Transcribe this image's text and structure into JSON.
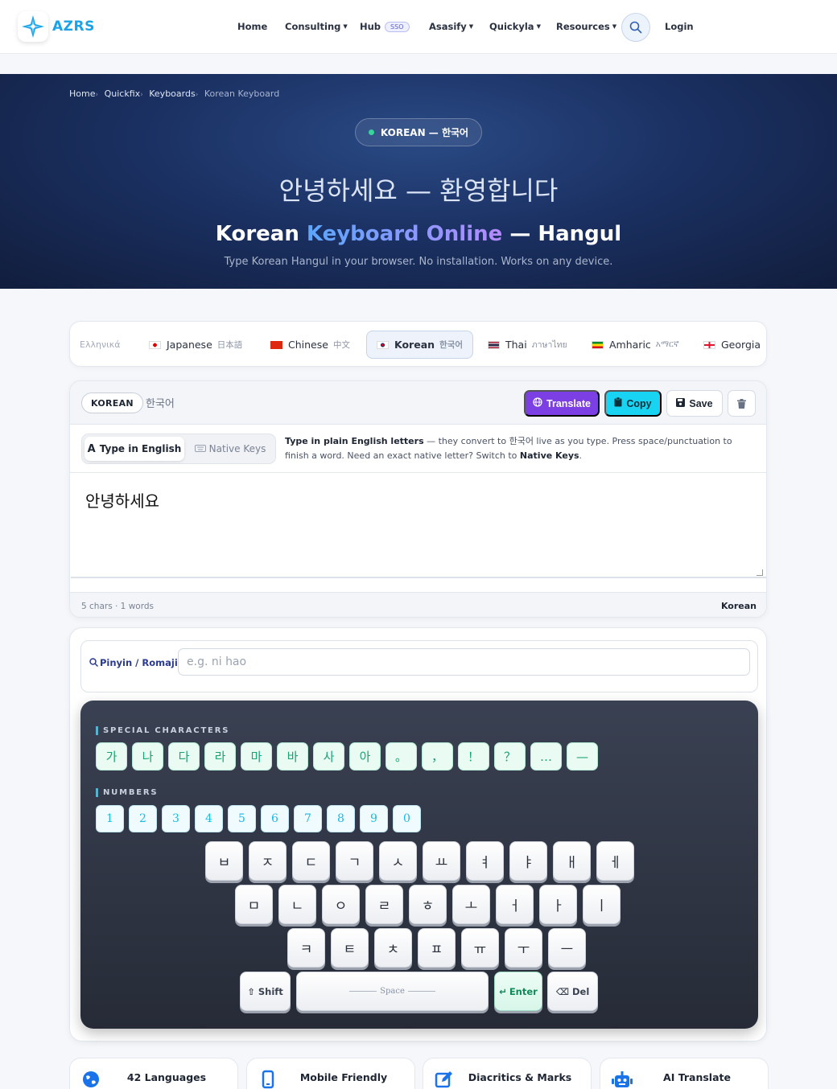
{
  "brand": {
    "name": "AZRS",
    "icon": "compass-star-icon",
    "color": "#1aa3e8"
  },
  "nav": {
    "items": [
      {
        "label": "Home",
        "dropdown": false
      },
      {
        "label": "Consulting",
        "dropdown": true
      },
      {
        "label": "Hub",
        "dropdown": false,
        "badge": "SSO"
      },
      {
        "label": "Asasify",
        "dropdown": true
      },
      {
        "label": "Quickyla",
        "dropdown": true
      },
      {
        "label": "Resources",
        "dropdown": true
      }
    ],
    "search_icon": "search-icon",
    "login": "Login"
  },
  "hero": {
    "breadcrumbs": [
      "Home",
      "Quickfix",
      "Keyboards",
      "Korean Keyboard"
    ],
    "pill": "KOREAN — 한국어",
    "native_greeting": "안녕하세요 — 환영합니다",
    "title_part1": "Korean ",
    "title_highlight": "Keyboard Online",
    "title_part2": " — Hangul",
    "subtitle": "Type Korean Hangul in your browser. No installation. Works on any device."
  },
  "languages": [
    {
      "label": "Ελληνικά",
      "native": "",
      "faded": true
    },
    {
      "label": "Japanese",
      "native": "日本語",
      "flag": "jp"
    },
    {
      "label": "Chinese",
      "native": "中文",
      "flag": "cn"
    },
    {
      "label": "Korean",
      "native": "한국어",
      "flag": "kr",
      "active": true
    },
    {
      "label": "Thai",
      "native": "ภาษาไทย",
      "flag": "th"
    },
    {
      "label": "Amharic",
      "native": "አማርኛ",
      "flag": "et"
    },
    {
      "label": "Georgia",
      "native": "",
      "flag": "ge"
    }
  ],
  "editor": {
    "lang_chip": "KOREAN",
    "lang_native": "한국어",
    "buttons": {
      "translate": "Translate",
      "copy": "Copy",
      "save": "Save"
    },
    "mode": {
      "english": "Type in English",
      "native": "Native Keys"
    },
    "help_bold1": "Type in plain English letters",
    "help_text1": " — they convert to 한국어 live as you type. Press space/punctuation to finish a word. Need an exact native letter? Switch to ",
    "help_bold2": "Native Keys",
    "help_text2": ".",
    "text": "안녕하세요",
    "count": "5 chars · 1 words",
    "footer_lang": "Korean"
  },
  "pinyin": {
    "label": "Pinyin / Romaji:",
    "placeholder": "e.g. ni hao"
  },
  "keyboard": {
    "special_title": "SPECIAL CHARACTERS",
    "special": [
      "가",
      "나",
      "다",
      "라",
      "마",
      "바",
      "사",
      "아",
      "。",
      "，",
      "！",
      "？",
      "…",
      "—"
    ],
    "numbers_title": "NUMBERS",
    "numbers": [
      "1",
      "2",
      "3",
      "4",
      "5",
      "6",
      "7",
      "8",
      "9",
      "0"
    ],
    "row1": [
      "ㅂ",
      "ㅈ",
      "ㄷ",
      "ㄱ",
      "ㅅ",
      "ㅛ",
      "ㅕ",
      "ㅑ",
      "ㅐ",
      "ㅔ"
    ],
    "row2": [
      "ㅁ",
      "ㄴ",
      "ㅇ",
      "ㄹ",
      "ㅎ",
      "ㅗ",
      "ㅓ",
      "ㅏ",
      "ㅣ"
    ],
    "row3": [
      "ㅋ",
      "ㅌ",
      "ㅊ",
      "ㅍ",
      "ㅠ",
      "ㅜ",
      "ㅡ"
    ],
    "shift": "Shift",
    "space": "Space",
    "enter": "Enter",
    "del": "Del"
  },
  "features": [
    {
      "label": "42 Languages",
      "icon": "globe-icon",
      "color": "#1a73e8"
    },
    {
      "label": "Mobile Friendly",
      "icon": "mobile-icon",
      "color": "#1a73e8"
    },
    {
      "label": "Diacritics & Marks",
      "icon": "edit-icon",
      "color": "#1a73e8"
    },
    {
      "label": "AI Translate",
      "icon": "robot-icon",
      "color": "#1a73e8"
    }
  ]
}
